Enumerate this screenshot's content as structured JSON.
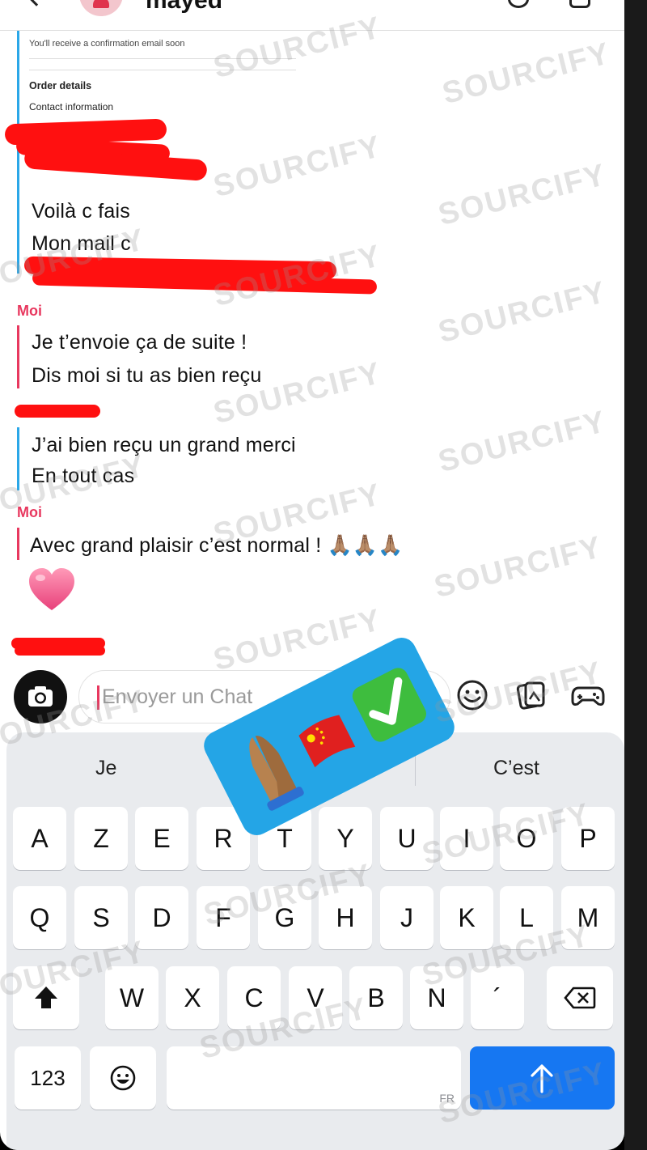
{
  "header": {
    "contact_name": "mayed"
  },
  "email_screenshot": {
    "confirmation_text": "You'll receive a confirmation email soon",
    "order_details_label": "Order details",
    "contact_info_label": "Contact information"
  },
  "messages": [
    {
      "sender": "",
      "lines": [
        "Voilà c fais",
        "Mon mail c"
      ]
    },
    {
      "sender": "Moi",
      "lines": [
        "Je t’envoie ça de suite !",
        "Dis moi si tu as bien reçu"
      ]
    },
    {
      "sender": "",
      "lines": [
        "J’ai bien reçu un grand merci",
        "En tout cas"
      ]
    },
    {
      "sender": "Moi",
      "lines": [
        "Avec grand plaisir c’est normal ! 🙏🏽🙏🏽🙏🏽"
      ]
    }
  ],
  "reaction_emoji": "heart",
  "composer": {
    "placeholder": "Envoyer un Chat"
  },
  "keyboard": {
    "suggestions": [
      "Je",
      "C’est"
    ],
    "row1": [
      "A",
      "Z",
      "E",
      "R",
      "T",
      "Y",
      "U",
      "I",
      "O",
      "P"
    ],
    "row2": [
      "Q",
      "S",
      "D",
      "F",
      "G",
      "H",
      "J",
      "K",
      "L",
      "M"
    ],
    "row3": [
      "W",
      "X",
      "C",
      "V",
      "B",
      "N",
      "´"
    ],
    "numbers_label": "123",
    "space_lang": "FR"
  },
  "sticker": {
    "emojis": [
      "🙏🏽",
      "🇨🇳",
      "✅"
    ]
  },
  "watermark": "SOURCIFY",
  "colors": {
    "friend_accent": "#2aa7e8",
    "me_accent": "#e8385f",
    "send_button": "#1677f2",
    "redaction": "#ff1010",
    "sticker_bg": "#24a5e6"
  }
}
